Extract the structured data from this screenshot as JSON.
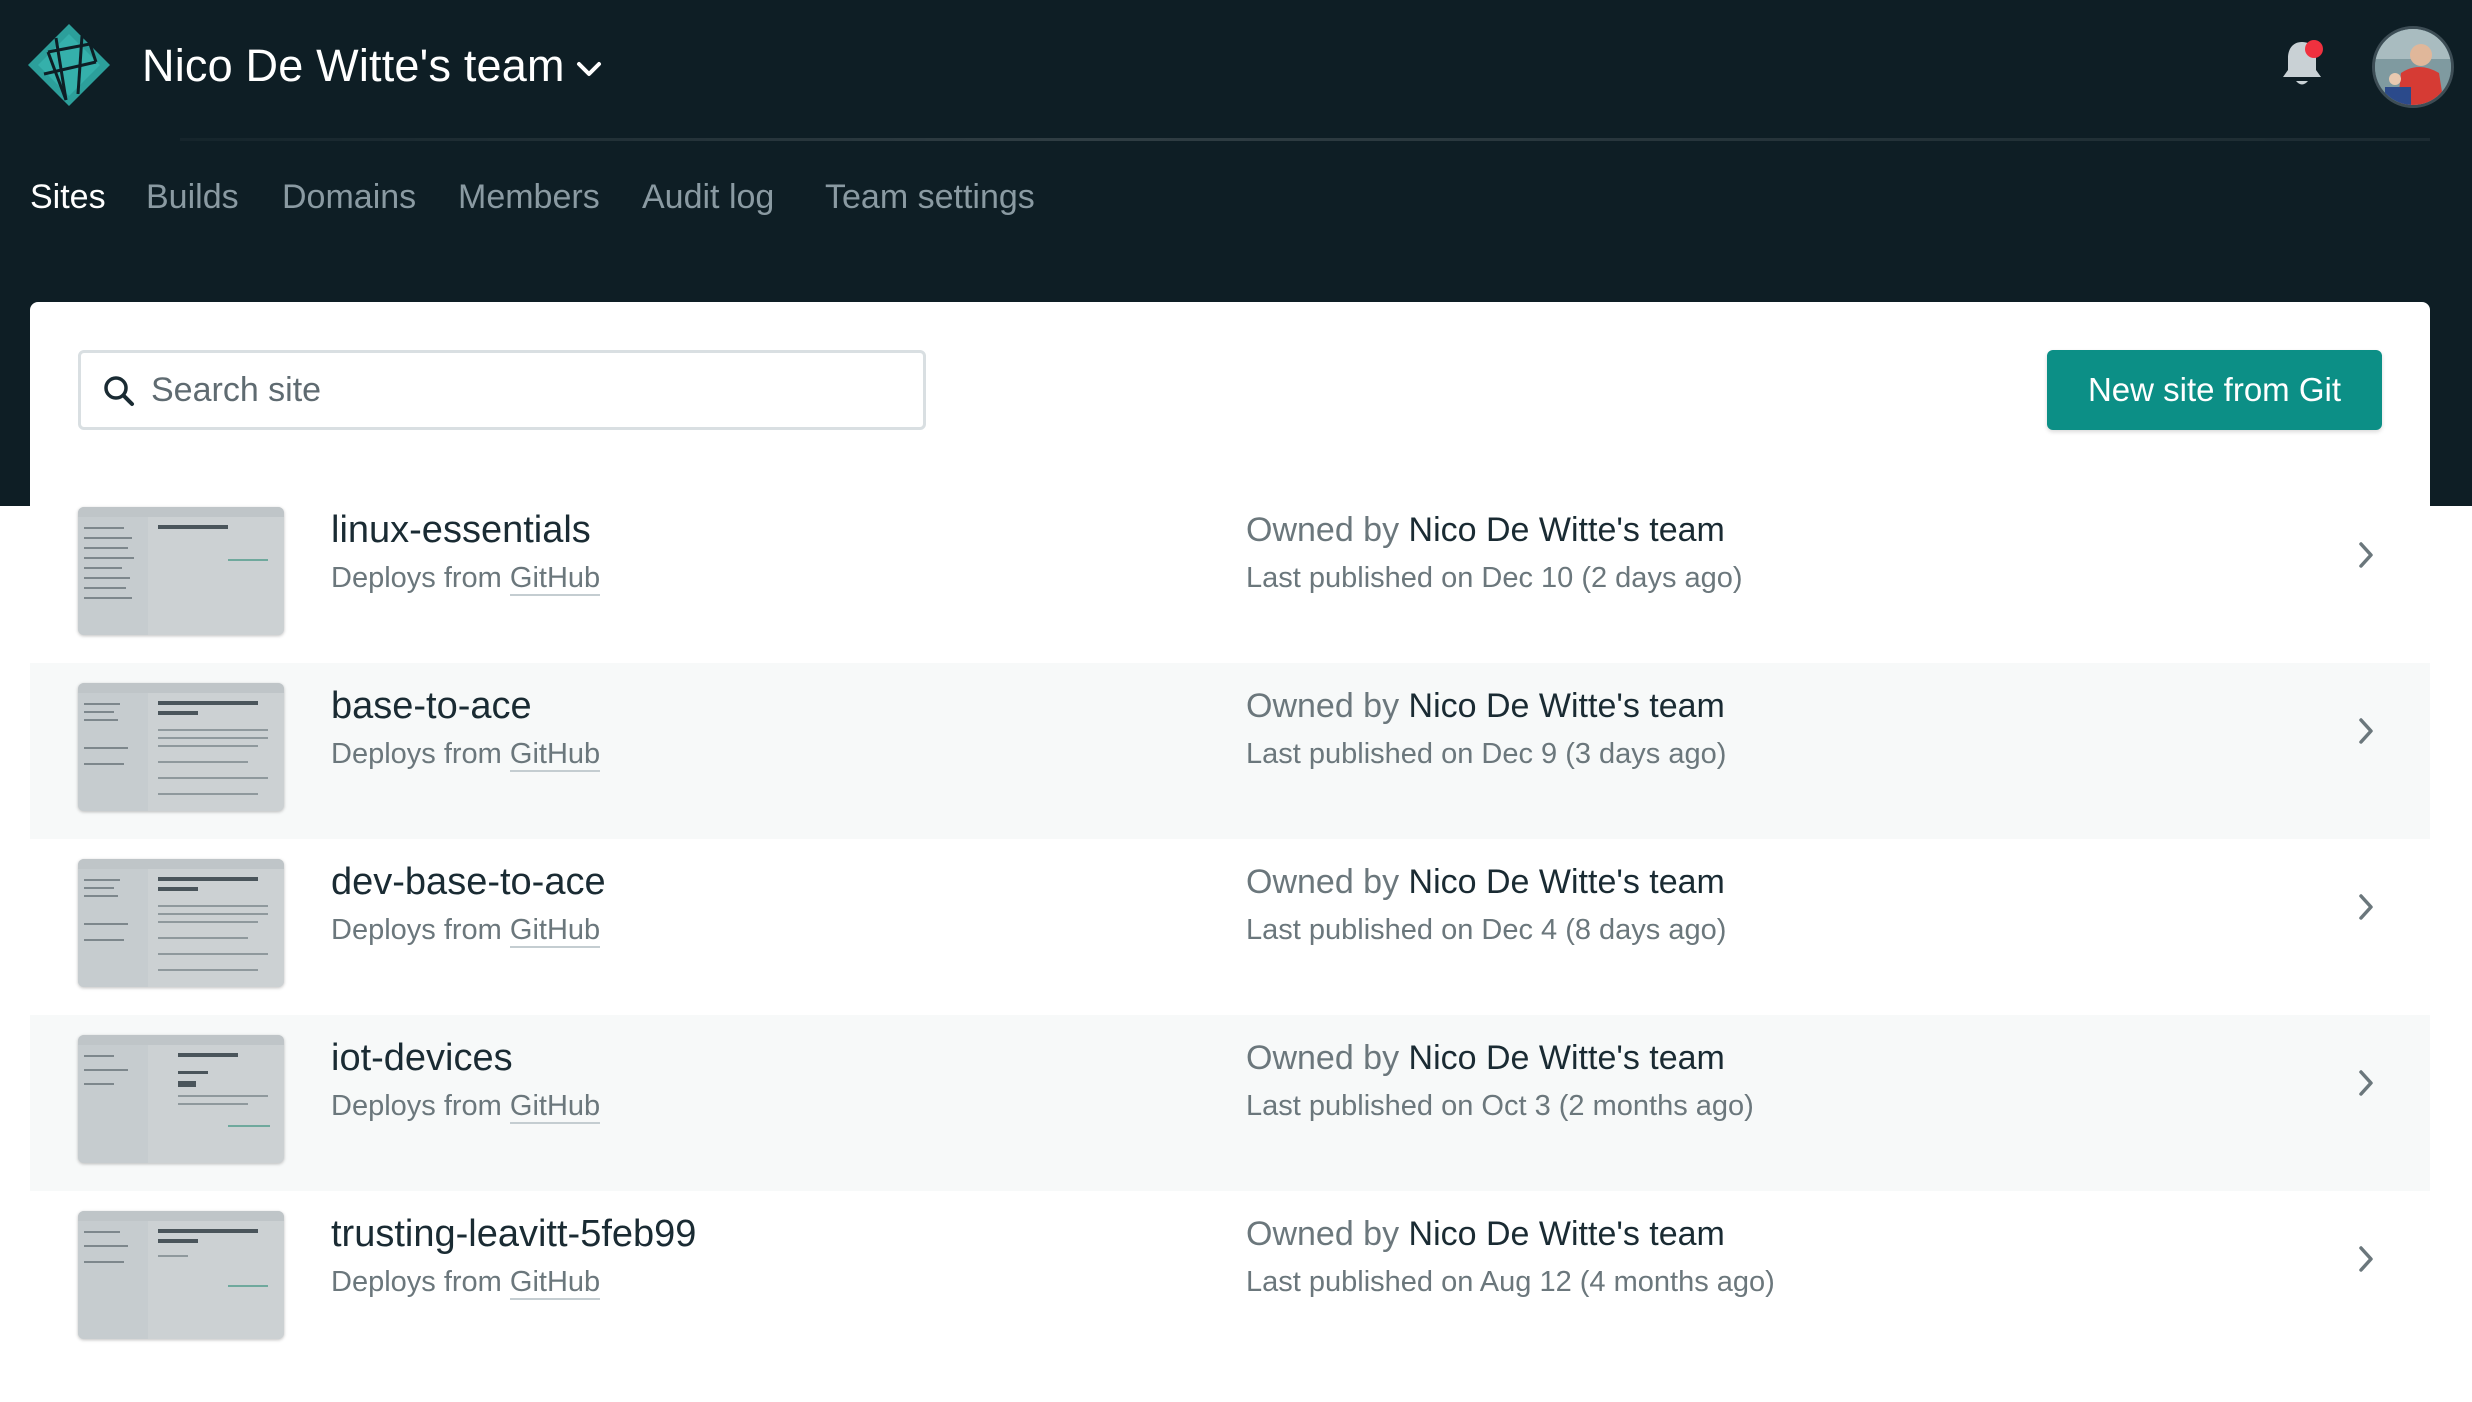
{
  "header": {
    "team_name": "Nico De Witte's team",
    "notification_dot_color": "#f0313f",
    "logo_icon": "netlify-logo",
    "avatar_icon": "user-avatar"
  },
  "nav": {
    "tabs": [
      {
        "label": "Sites",
        "active": true
      },
      {
        "label": "Builds",
        "active": false
      },
      {
        "label": "Domains",
        "active": false
      },
      {
        "label": "Members",
        "active": false
      },
      {
        "label": "Audit log",
        "active": false
      },
      {
        "label": "Team settings",
        "active": false
      }
    ]
  },
  "toolbar": {
    "search_placeholder": "Search site",
    "new_site_label": "New site from Git",
    "accent_color": "#0c8f86"
  },
  "sites": [
    {
      "name": "linux-essentials",
      "deploys_prefix": "Deploys from ",
      "deploys_source": "GitHub",
      "owned_prefix": "Owned by ",
      "owner": "Nico De Witte's team",
      "published": "Last published on Dec 10 (2 days ago)"
    },
    {
      "name": "base-to-ace",
      "deploys_prefix": "Deploys from ",
      "deploys_source": "GitHub",
      "owned_prefix": "Owned by ",
      "owner": "Nico De Witte's team",
      "published": "Last published on Dec 9 (3 days ago)"
    },
    {
      "name": "dev-base-to-ace",
      "deploys_prefix": "Deploys from ",
      "deploys_source": "GitHub",
      "owned_prefix": "Owned by ",
      "owner": "Nico De Witte's team",
      "published": "Last published on Dec 4 (8 days ago)"
    },
    {
      "name": "iot-devices",
      "deploys_prefix": "Deploys from ",
      "deploys_source": "GitHub",
      "owned_prefix": "Owned by ",
      "owner": "Nico De Witte's team",
      "published": "Last published on Oct 3 (2 months ago)"
    },
    {
      "name": "trusting-leavitt-5feb99",
      "deploys_prefix": "Deploys from ",
      "deploys_source": "GitHub",
      "owned_prefix": "Owned by ",
      "owner": "Nico De Witte's team",
      "published": "Last published on Aug 12 (4 months ago)"
    }
  ]
}
